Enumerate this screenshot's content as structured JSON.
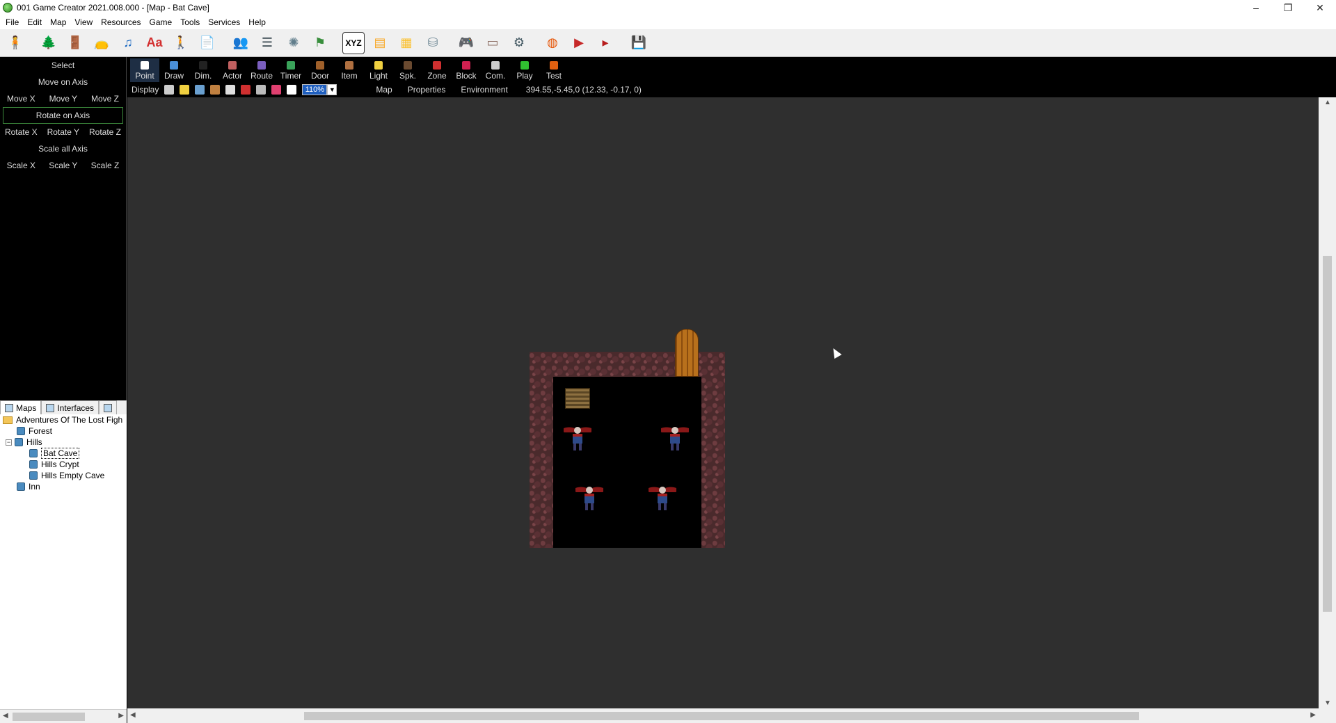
{
  "window": {
    "title": "001 Game Creator 2021.008.000 - [Map - Bat Cave]",
    "minimize": "–",
    "maximize": "❐",
    "close": "✕"
  },
  "menu": [
    "File",
    "Edit",
    "Map",
    "View",
    "Resources",
    "Game",
    "Tools",
    "Services",
    "Help"
  ],
  "toolbar_icons": [
    {
      "name": "actor-icon",
      "glyph": "🧍",
      "color": "#c62828"
    },
    {
      "name": "tree-icon",
      "glyph": "🌲",
      "color": "#2e7d32"
    },
    {
      "name": "door-icon",
      "glyph": "🚪",
      "color": "#8d5a2b"
    },
    {
      "name": "bag-icon",
      "glyph": "👝",
      "color": "#8d6e63"
    },
    {
      "name": "music-icon",
      "glyph": "♫",
      "color": "#1565c0"
    },
    {
      "name": "font-icon",
      "glyph": "Aa",
      "color": "#d32f2f"
    },
    {
      "name": "character-icon",
      "glyph": "🚶",
      "color": "#555555"
    },
    {
      "name": "document-icon",
      "glyph": "📄",
      "color": "#1e3a5f"
    },
    {
      "name": "party-icon",
      "glyph": "👥",
      "color": "#1976d2"
    },
    {
      "name": "list-icon",
      "glyph": "☰",
      "color": "#37474f"
    },
    {
      "name": "monster-icon",
      "glyph": "✺",
      "color": "#607d8b"
    },
    {
      "name": "skills-icon",
      "glyph": "⚑",
      "color": "#388e3c"
    },
    {
      "name": "xyz-icon",
      "glyph": "XYZ",
      "color": "#000000"
    },
    {
      "name": "window-icon",
      "glyph": "▤",
      "color": "#f9a825"
    },
    {
      "name": "notes-icon",
      "glyph": "▦",
      "color": "#fbc02d"
    },
    {
      "name": "database-icon",
      "glyph": "⛁",
      "color": "#78909c"
    },
    {
      "name": "gamepad-icon",
      "glyph": "🎮",
      "color": "#424242"
    },
    {
      "name": "interface-icon",
      "glyph": "▭",
      "color": "#8d6e63"
    },
    {
      "name": "settings-icon",
      "glyph": "⚙",
      "color": "#455a64"
    },
    {
      "name": "ball-icon",
      "glyph": "◍",
      "color": "#e65100"
    },
    {
      "name": "play-game-icon",
      "glyph": "▶",
      "color": "#c62828"
    },
    {
      "name": "test-game-icon",
      "glyph": "▸",
      "color": "#b71c1c"
    },
    {
      "name": "save-icon",
      "glyph": "💾",
      "color": "#1565c0"
    }
  ],
  "left_tools": {
    "select": "Select",
    "move_axis": "Move on Axis",
    "move": [
      "Move X",
      "Move Y",
      "Move Z"
    ],
    "rotate_axis": "Rotate on Axis",
    "rotate": [
      "Rotate X",
      "Rotate Y",
      "Rotate Z"
    ],
    "scale_axis": "Scale all Axis",
    "scale": [
      "Scale X",
      "Scale Y",
      "Scale Z"
    ]
  },
  "tree_tabs": {
    "maps": "Maps",
    "interfaces": "Interfaces"
  },
  "tree": {
    "root": "Adventures Of The Lost Figh",
    "forest": "Forest",
    "hills": "Hills",
    "bat_cave": "Bat Cave",
    "hills_crypt": "Hills Crypt",
    "hills_empty_cave": "Hills Empty Cave",
    "inn": "Inn",
    "expander": "−"
  },
  "object_tools": [
    {
      "name": "point",
      "label": "Point",
      "color": "#ffffff"
    },
    {
      "name": "draw",
      "label": "Draw",
      "color": "#4a90d9"
    },
    {
      "name": "dim",
      "label": "Dim.",
      "color": "#222222"
    },
    {
      "name": "actor",
      "label": "Actor",
      "color": "#c06060"
    },
    {
      "name": "route",
      "label": "Route",
      "color": "#7b5fbf"
    },
    {
      "name": "timer",
      "label": "Timer",
      "color": "#3aa35a"
    },
    {
      "name": "door",
      "label": "Door",
      "color": "#a0602a"
    },
    {
      "name": "item",
      "label": "Item",
      "color": "#b07040"
    },
    {
      "name": "light",
      "label": "Light",
      "color": "#f0d040"
    },
    {
      "name": "spk",
      "label": "Spk.",
      "color": "#6a4a30"
    },
    {
      "name": "zone",
      "label": "Zone",
      "color": "#d03030"
    },
    {
      "name": "block",
      "label": "Block",
      "color": "#d02050"
    },
    {
      "name": "com",
      "label": "Com.",
      "color": "#cccccc"
    },
    {
      "name": "play",
      "label": "Play",
      "color": "#30c030"
    },
    {
      "name": "test",
      "label": "Test",
      "color": "#e06010"
    }
  ],
  "display": {
    "label": "Display",
    "icons": [
      {
        "name": "layers-icon",
        "color": "#cccccc"
      },
      {
        "name": "bulb-icon",
        "color": "#f0d040"
      },
      {
        "name": "weather-icon",
        "color": "#6aa0d0"
      },
      {
        "name": "sound-icon",
        "color": "#c08040"
      },
      {
        "name": "grid-icon",
        "color": "#dddddd"
      },
      {
        "name": "magnet-icon",
        "color": "#d03030"
      },
      {
        "name": "stack-icon",
        "color": "#bbbbbb"
      },
      {
        "name": "book-icon",
        "color": "#e04070"
      },
      {
        "name": "info-icon",
        "color": "#ffffff"
      }
    ],
    "zoom": "110%",
    "zoom_arrow": "▼",
    "tabs": [
      "Map",
      "Properties",
      "Environment"
    ],
    "coords": "394.55,-5.45,0 (12.33, -0.17, 0)"
  },
  "scroll": {
    "left": "◀",
    "right": "▶",
    "up": "▲",
    "down": "▼"
  }
}
